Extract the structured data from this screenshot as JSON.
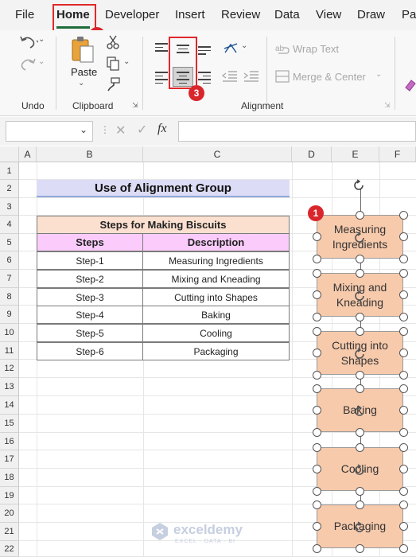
{
  "menu": {
    "tabs": [
      "File",
      "Home",
      "Developer",
      "Insert",
      "Review",
      "Data",
      "View",
      "Draw",
      "Pag"
    ]
  },
  "ribbon": {
    "groups": {
      "undo": "Undo",
      "clipboard": "Clipboard",
      "alignment": "Alignment"
    },
    "paste_label": "Paste",
    "wrap_text": "Wrap Text",
    "merge_center": "Merge & Center"
  },
  "formula_bar": {
    "fx": "fx",
    "name_box_value": "",
    "formula_value": ""
  },
  "grid": {
    "columns": [
      "A",
      "B",
      "C",
      "D",
      "E",
      "F"
    ],
    "rows": [
      "1",
      "2",
      "3",
      "4",
      "5",
      "6",
      "7",
      "8",
      "9",
      "10",
      "11",
      "12",
      "13",
      "14",
      "15",
      "16",
      "17",
      "18",
      "19",
      "20",
      "21",
      "22"
    ]
  },
  "sheet": {
    "title": "Use of Alignment Group",
    "table": {
      "caption": "Steps for Making Biscuits",
      "headers": [
        "Steps",
        "Description"
      ],
      "rows": [
        [
          "Step-1",
          "Measuring Ingredients"
        ],
        [
          "Step-2",
          "Mixing and Kneading"
        ],
        [
          "Step-3",
          "Cutting into Shapes"
        ],
        [
          "Step-4",
          "Baking"
        ],
        [
          "Step-5",
          "Cooling"
        ],
        [
          "Step-6",
          "Packaging"
        ]
      ]
    }
  },
  "shapes": [
    "Measuring Ingredients",
    "Mixing and Kneading",
    "Cutting into Shapes",
    "Baking",
    "Cooling",
    "Packaging"
  ],
  "badges": [
    "1",
    "2",
    "3"
  ],
  "watermark": {
    "name": "exceldemy",
    "tagline": "EXCEL · DATA · BI"
  },
  "colors": {
    "accent_red": "#d9262c",
    "title_fill": "#dcdcf6",
    "caption_fill": "#fbe0d0",
    "header_fill": "#fbccfb",
    "shape_fill": "#f7caac",
    "home_underline": "#1e6b3a"
  },
  "icons": [
    "undo-icon",
    "redo-icon",
    "paste-icon",
    "cut-icon",
    "copy-icon",
    "format-painter-icon",
    "align-top-icon",
    "align-middle-icon",
    "align-bottom-icon",
    "align-left-icon",
    "align-center-icon",
    "align-right-icon",
    "orientation-icon",
    "decrease-indent-icon",
    "increase-indent-icon",
    "wrap-text-icon",
    "merge-center-icon",
    "cancel-icon",
    "enter-icon",
    "rotate-handle-icon"
  ]
}
